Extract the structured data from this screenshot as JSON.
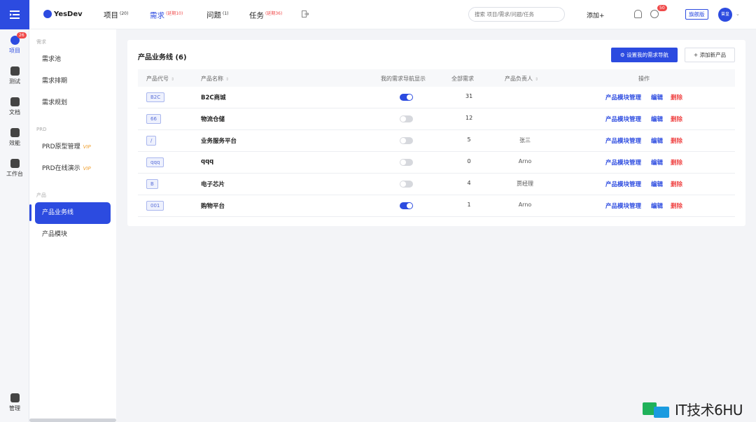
{
  "rail": {
    "items": [
      {
        "label": "项目",
        "badge": "26",
        "icon": "project-icon"
      },
      {
        "label": "测试",
        "icon": "test-icon"
      },
      {
        "label": "文档",
        "icon": "doc-icon"
      },
      {
        "label": "效能",
        "icon": "chart-icon"
      },
      {
        "label": "工作台",
        "icon": "workbench-icon"
      }
    ],
    "bottom_label": "管理"
  },
  "header": {
    "logo": "YesDev",
    "nav": [
      {
        "label": "项目",
        "count": "(20)",
        "delay": ""
      },
      {
        "label": "需求",
        "count": "",
        "delay": "(延期10)"
      },
      {
        "label": "问题",
        "count": "(1)",
        "delay": ""
      },
      {
        "label": "任务",
        "count": "",
        "delay": "(延期36)"
      }
    ],
    "search_placeholder": "搜索 项目/需求/问题/任务",
    "add_label": "添加+",
    "notif_badge": "50",
    "edition": "旗舰版",
    "avatar": "曾皇"
  },
  "sidebar": {
    "sec1": "需求",
    "req_pool": "需求池",
    "req_schedule": "需求排期",
    "req_plan": "需求规划",
    "sec2": "PRD",
    "prd_proto": "PRD原型管理",
    "prd_demo": "PRD在线演示",
    "vip": "VIP",
    "sec3": "产品",
    "product_line": "产品业务线",
    "product_module": "产品模块"
  },
  "main": {
    "title": "产品业务线 (6)",
    "btn_nav": "设置我的需求导航",
    "btn_add": "+ 添加新产品",
    "columns": {
      "code": "产品代号",
      "name": "产品名称",
      "nav": "我的需求导航显示",
      "total": "全部需求",
      "owner": "产品负责人",
      "ops": "操作"
    },
    "rows": [
      {
        "code": "B2C",
        "name": "B2C商城",
        "nav_on": true,
        "total": "31",
        "owner": ""
      },
      {
        "code": "66",
        "name": "物流仓储",
        "nav_on": false,
        "total": "12",
        "owner": ""
      },
      {
        "code": "/",
        "name": "业务服务平台",
        "nav_on": false,
        "total": "5",
        "owner": "张三"
      },
      {
        "code": "qqq",
        "name": "qqq",
        "nav_on": false,
        "total": "0",
        "owner": "Arno"
      },
      {
        "code": "B",
        "name": "电子芯片",
        "nav_on": false,
        "total": "4",
        "owner": "贾经理"
      },
      {
        "code": "001",
        "name": "购物平台",
        "nav_on": true,
        "total": "1",
        "owner": "Arno"
      }
    ],
    "action_module": "产品模块管理",
    "action_edit": "编辑",
    "action_delete": "删除"
  },
  "watermark": "IT技术6HU",
  "colors": {
    "accent": "#2c4be0",
    "danger": "#f04a4a",
    "vip": "#f0a030"
  }
}
